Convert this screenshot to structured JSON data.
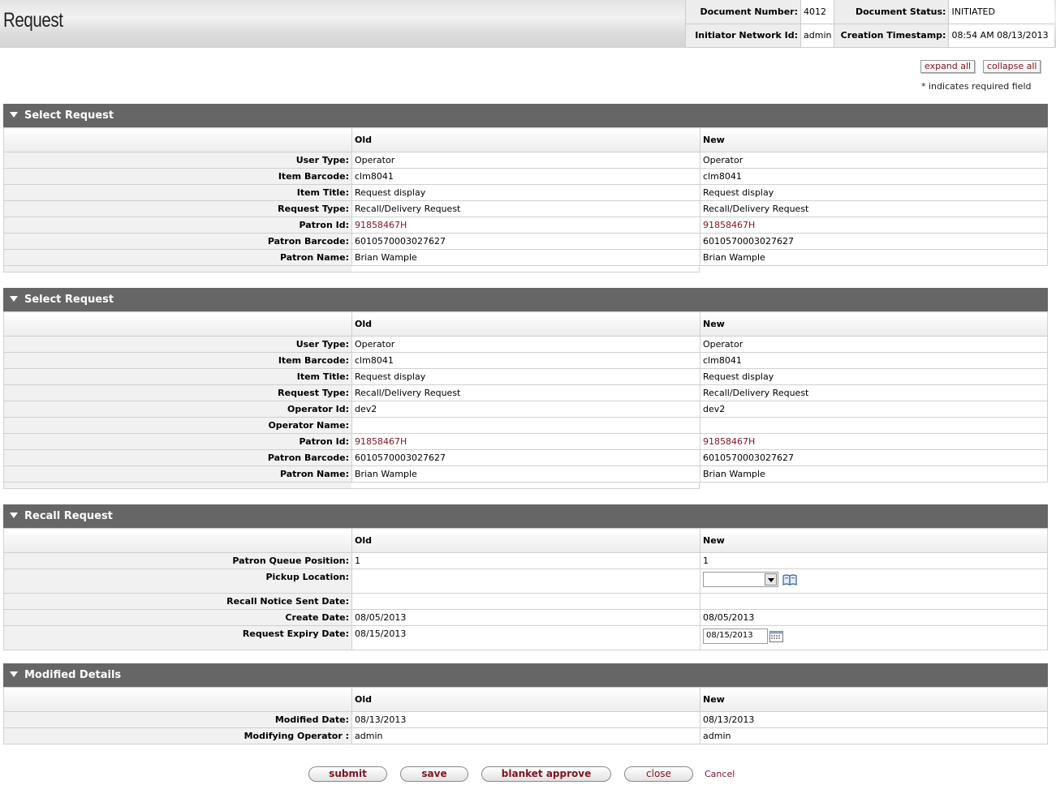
{
  "header": {
    "title": "Request",
    "document_number_label": "Document Number:",
    "document_number": "4012",
    "document_status_label": "Document Status:",
    "document_status": "INITIATED",
    "initiator_label": "Initiator Network Id:",
    "initiator": "admin",
    "timestamp_label": "Creation Timestamp:",
    "timestamp": "08:54 AM 08/13/2013"
  },
  "toolbar": {
    "expand_all": "expand all",
    "collapse_all": "collapse all",
    "required_note": "* indicates required field"
  },
  "columns": {
    "old": "Old",
    "new": "New"
  },
  "sections": [
    {
      "title": "Select Request",
      "rows": [
        {
          "label": "User Type:",
          "old": "Operator",
          "new": "Operator"
        },
        {
          "label": "Item Barcode:",
          "old": "clm8041",
          "new": "clm8041"
        },
        {
          "label": "Item Title:",
          "old": "Request display",
          "new": "Request display"
        },
        {
          "label": "Request Type:",
          "old": "Recall/Delivery Request",
          "new": "Recall/Delivery Request"
        },
        {
          "label": "Patron Id:",
          "old": "91858467H",
          "new": "91858467H"
        },
        {
          "label": "Patron Barcode:",
          "old": "6010570003027627",
          "new": "6010570003027627"
        },
        {
          "label": "Patron Name:",
          "old": "Brian Wample",
          "new": "Brian Wample"
        }
      ]
    },
    {
      "title": "Select Request",
      "rows": [
        {
          "label": "User Type:",
          "old": "Operator",
          "new": "Operator"
        },
        {
          "label": "Item Barcode:",
          "old": "clm8041",
          "new": "clm8041"
        },
        {
          "label": "Item Title:",
          "old": "Request display",
          "new": "Request display"
        },
        {
          "label": "Request Type:",
          "old": "Recall/Delivery Request",
          "new": "Recall/Delivery Request"
        },
        {
          "label": "Operator Id:",
          "old": "dev2",
          "new": "dev2"
        },
        {
          "label": "Operator Name:",
          "old": "",
          "new": ""
        },
        {
          "label": "Patron Id:",
          "old": "91858467H",
          "new": "91858467H"
        },
        {
          "label": "Patron Barcode:",
          "old": "6010570003027627",
          "new": "6010570003027627"
        },
        {
          "label": "Patron Name:",
          "old": "Brian Wample",
          "new": "Brian Wample"
        }
      ]
    },
    {
      "title": "Recall Request",
      "rows": [
        {
          "label": "Patron Queue Position:",
          "old": "1",
          "new": "1"
        },
        {
          "label": "Pickup Location:",
          "old": "",
          "new": ""
        },
        {
          "label": "Recall Notice Sent Date:",
          "old": "",
          "new": ""
        },
        {
          "label": "Create Date:",
          "old": "08/05/2013",
          "new": "08/05/2013"
        },
        {
          "label": "Request Expiry Date:",
          "old": "08/15/2013",
          "new": "08/15/2013"
        }
      ]
    },
    {
      "title": "Modified Details",
      "rows": [
        {
          "label": "Modified Date:",
          "old": "08/13/2013",
          "new": "08/13/2013"
        },
        {
          "label": "Modifying Operator :",
          "old": "admin",
          "new": "admin"
        }
      ]
    }
  ],
  "buttons": {
    "submit": "submit",
    "save": "save",
    "blanket_approve": "blanket approve",
    "close": "close",
    "cancel": "Cancel"
  },
  "colors": {
    "section_header": "#666666",
    "link": "#7b1520"
  }
}
